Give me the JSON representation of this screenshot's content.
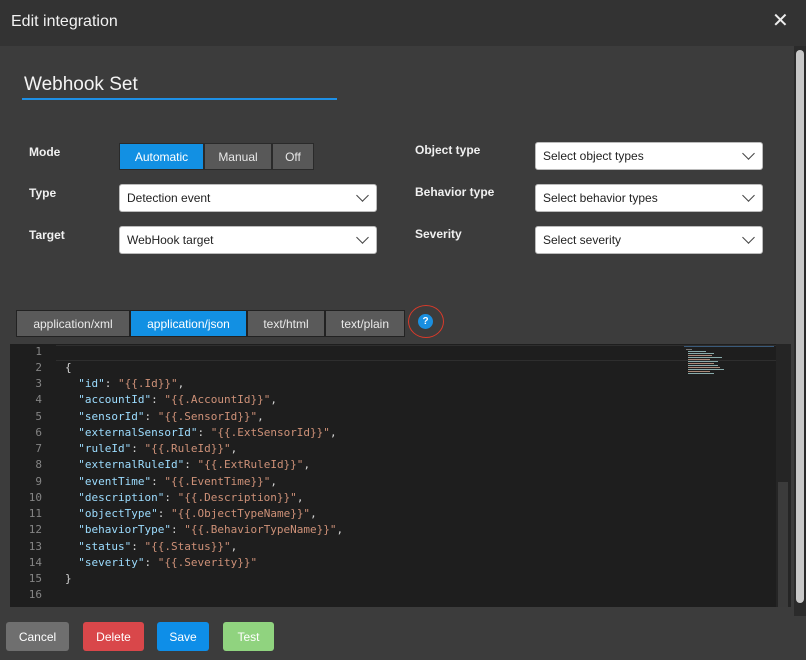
{
  "dialog": {
    "title": "Edit integration",
    "close_glyph": "✕"
  },
  "name_field": {
    "value": "Webhook Set"
  },
  "form": {
    "mode": {
      "label": "Mode",
      "options": [
        "Automatic",
        "Manual",
        "Off"
      ],
      "selected": "Automatic"
    },
    "type": {
      "label": "Type",
      "value": "Detection event"
    },
    "target": {
      "label": "Target",
      "value": "WebHook target"
    },
    "object_type": {
      "label": "Object type",
      "value": "Select object types"
    },
    "behavior_type": {
      "label": "Behavior type",
      "value": "Select behavior types"
    },
    "severity": {
      "label": "Severity",
      "value": "Select severity"
    }
  },
  "format_tabs": {
    "items": [
      "application/xml",
      "application/json",
      "text/html",
      "text/plain"
    ],
    "selected": "application/json"
  },
  "help": {
    "glyph": "?"
  },
  "editor": {
    "line_numbers": [
      "1",
      "2",
      "3",
      "4",
      "5",
      "6",
      "7",
      "8",
      "9",
      "10",
      "11",
      "12",
      "13",
      "14",
      "15",
      "16"
    ],
    "open_brace": "{",
    "close_brace": "}",
    "fields": [
      {
        "key": "\"id\"",
        "value": "\"{{.Id}}\"",
        "sep": ","
      },
      {
        "key": "\"accountId\"",
        "value": "\"{{.AccountId}}\"",
        "sep": ","
      },
      {
        "key": "\"sensorId\"",
        "value": "\"{{.SensorId}}\"",
        "sep": ","
      },
      {
        "key": "\"externalSensorId\"",
        "value": "\"{{.ExtSensorId}}\"",
        "sep": ","
      },
      {
        "key": "\"ruleId\"",
        "value": "\"{{.RuleId}}\"",
        "sep": ","
      },
      {
        "key": "\"externalRuleId\"",
        "value": "\"{{.ExtRuleId}}\"",
        "sep": ","
      },
      {
        "key": "\"eventTime\"",
        "value": "\"{{.EventTime}}\"",
        "sep": ","
      },
      {
        "key": "\"description\"",
        "value": "\"{{.Description}}\"",
        "sep": ","
      },
      {
        "key": "\"objectType\"",
        "value": "\"{{.ObjectTypeName}}\"",
        "sep": ","
      },
      {
        "key": "\"behaviorType\"",
        "value": "\"{{.BehaviorTypeName}}\"",
        "sep": ","
      },
      {
        "key": "\"status\"",
        "value": "\"{{.Status}}\"",
        "sep": ","
      },
      {
        "key": "\"severity\"",
        "value": "\"{{.Severity}}\"",
        "sep": ""
      }
    ]
  },
  "footer": {
    "cancel": "Cancel",
    "delete": "Delete",
    "save": "Save",
    "test": "Test"
  },
  "colors": {
    "accent": "#1290e3",
    "cancel": "#6f6f6f",
    "delete": "#d9474a",
    "save": "#0e8ee8",
    "test": "#90d37f",
    "help_ring": "#d83a2a"
  }
}
